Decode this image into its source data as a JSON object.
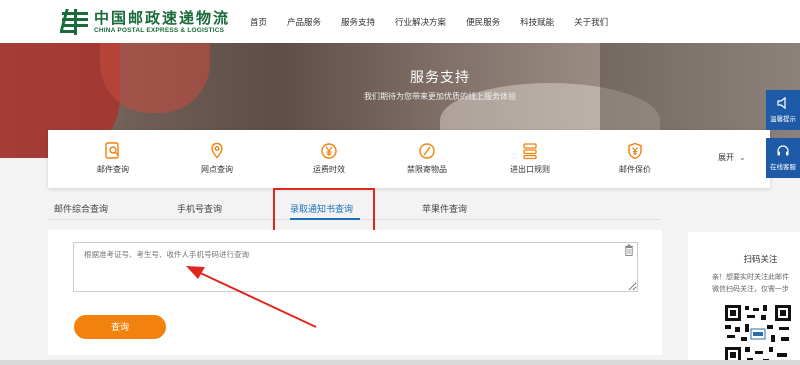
{
  "logo": {
    "cn": "中国邮政速递物流",
    "en": "CHINA POSTAL EXPRESS & LOGISTICS"
  },
  "nav": [
    "首页",
    "产品服务",
    "服务支持",
    "行业解决方案",
    "便民服务",
    "科技赋能",
    "关于我们"
  ],
  "banner": {
    "title": "服务支持",
    "subtitle": "我们期待为您带来更加优质的线上服务体验"
  },
  "services": [
    {
      "label": "邮件查询",
      "icon": "search-doc-icon"
    },
    {
      "label": "网点查询",
      "icon": "location-icon"
    },
    {
      "label": "运费时效",
      "icon": "yen-icon"
    },
    {
      "label": "禁限寄物品",
      "icon": "forbidden-icon"
    },
    {
      "label": "进出口规则",
      "icon": "rules-icon"
    },
    {
      "label": "邮件保价",
      "icon": "shield-yen-icon"
    }
  ],
  "expand_label": "展开",
  "float": {
    "tips": "温馨提示",
    "service": "在线客服"
  },
  "tabs": [
    "邮件综合查询",
    "手机号查询",
    "录取通知书查询",
    "苹果件查询"
  ],
  "active_tab": 2,
  "query": {
    "placeholder": "根据准考证号、考生号、收件人手机号码进行查询",
    "button": "查询"
  },
  "qr": {
    "title": "扫码关注",
    "desc1": "亲！想要实时关注此邮件",
    "desc2": "微信扫码关注，仅需一步"
  },
  "colors": {
    "brand_green": "#1a6b3c",
    "accent_orange": "#f0820d",
    "link_blue": "#1d6fbf",
    "highlight_red": "#e0271e"
  }
}
